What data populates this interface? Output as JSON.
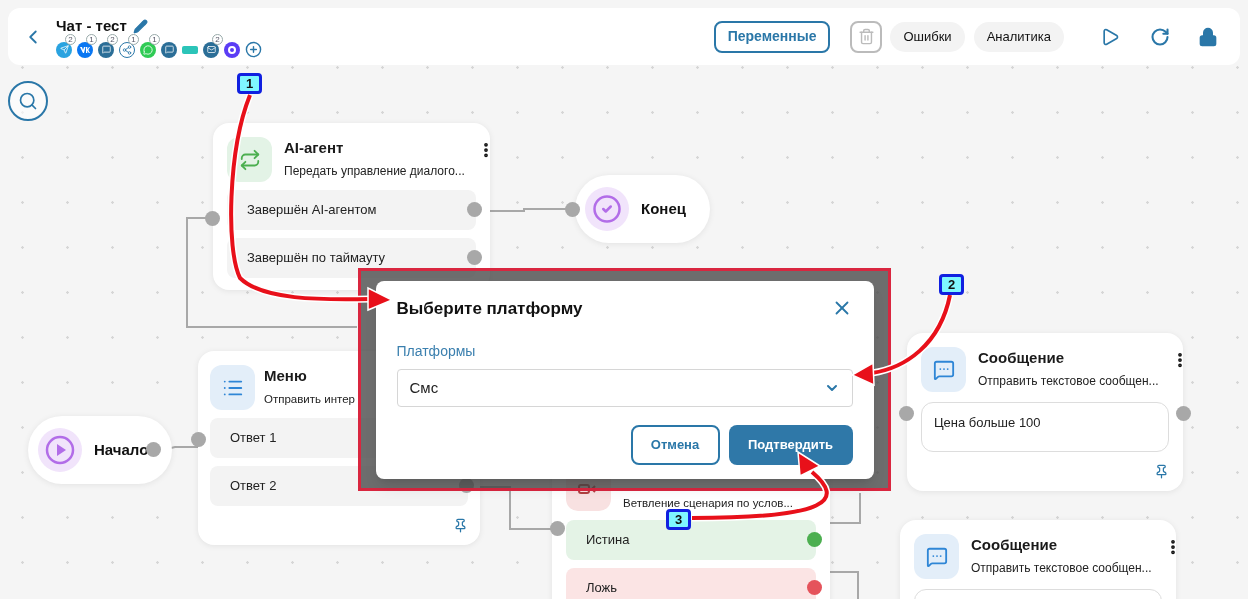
{
  "header": {
    "title": "Чат - тест",
    "channel_counts": [
      "2",
      "1",
      "2",
      "1",
      "1",
      "2"
    ],
    "variables": "Переменные",
    "errors": "Ошибки",
    "analytics": "Аналитика"
  },
  "nodes": [
    {
      "kind": "block",
      "title": "AI-агент",
      "subtitle": "Передать управление диалого...",
      "outputs": [
        {
          "label": "Завершён AI-агентом"
        },
        {
          "label": "Завершён по таймауту"
        }
      ]
    },
    {
      "kind": "end",
      "title": "Конец"
    },
    {
      "kind": "start",
      "title": "Начало"
    },
    {
      "kind": "block",
      "title": "Меню",
      "subtitle": "Отправить интер",
      "outputs": [
        {
          "label": "Ответ 1"
        },
        {
          "label": "Ответ 2"
        }
      ]
    },
    {
      "kind": "block",
      "subtitle": "Ветвление сценария по услов...",
      "outputs": [
        {
          "label": "Истина",
          "color": "#4caf50"
        },
        {
          "label": "Ложь",
          "color": "#e5535b"
        }
      ]
    },
    {
      "kind": "block",
      "title": "Сообщение",
      "subtitle": "Отправить текстовое сообщен...",
      "body": "Цена больше 100"
    },
    {
      "kind": "block",
      "title": "Сообщение",
      "subtitle": "Отправить текстовое сообщен..."
    }
  ],
  "dialog": {
    "title": "Выберите платформу",
    "label": "Платформы",
    "value": "Смс",
    "cancel": "Отмена",
    "confirm": "Подтвердить"
  },
  "callouts": [
    "1",
    "2",
    "3"
  ]
}
